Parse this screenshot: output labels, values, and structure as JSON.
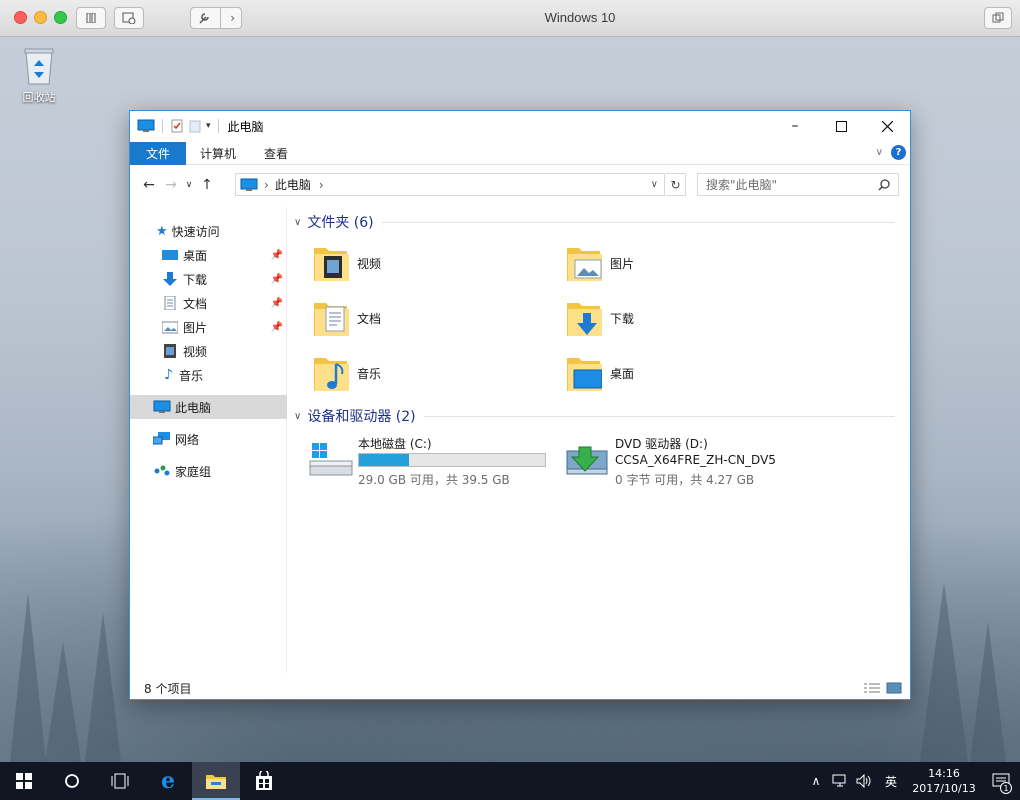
{
  "vm": {
    "title": "Windows 10"
  },
  "desktop": {
    "recycle_bin_label": "回收站"
  },
  "window": {
    "title": "此电脑",
    "ribbon_tabs": [
      {
        "label": "文件",
        "active": true
      },
      {
        "label": "计算机",
        "active": false
      },
      {
        "label": "查看",
        "active": false
      }
    ],
    "help_icon": "?",
    "address": {
      "crumb": "此电脑"
    },
    "search": {
      "placeholder": "搜索\"此电脑\""
    },
    "nav": {
      "quick_access": "快速访问",
      "items": [
        {
          "label": "桌面",
          "pinned": true,
          "icon": "desktop-icon"
        },
        {
          "label": "下载",
          "pinned": true,
          "icon": "download-icon"
        },
        {
          "label": "文档",
          "pinned": true,
          "icon": "documents-icon"
        },
        {
          "label": "图片",
          "pinned": true,
          "icon": "pictures-icon"
        },
        {
          "label": "视频",
          "pinned": false,
          "icon": "videos-icon"
        },
        {
          "label": "音乐",
          "pinned": false,
          "icon": "music-icon"
        }
      ],
      "this_pc": "此电脑",
      "network": "网络",
      "homegroup": "家庭组"
    },
    "groups": {
      "folders_header": "文件夹 (6)",
      "folders": [
        {
          "label": "视频",
          "icon": "videos-folder-icon"
        },
        {
          "label": "图片",
          "icon": "pictures-folder-icon"
        },
        {
          "label": "文档",
          "icon": "documents-folder-icon"
        },
        {
          "label": "下载",
          "icon": "downloads-folder-icon"
        },
        {
          "label": "音乐",
          "icon": "music-folder-icon"
        },
        {
          "label": "桌面",
          "icon": "desktop-folder-icon"
        }
      ],
      "devices_header": "设备和驱动器 (2)",
      "drives": [
        {
          "name": "本地磁盘 (C:)",
          "detail": "29.0 GB 可用，共 39.5 GB",
          "used_fraction": 0.27
        },
        {
          "name": "DVD 驱动器 (D:)",
          "volume": "CCSA_X64FRE_ZH-CN_DV5",
          "detail": "0 字节 可用，共 4.27 GB"
        }
      ]
    },
    "status": {
      "item_count": "8 个项目"
    }
  },
  "taskbar": {
    "ime": "英",
    "time": "14:16",
    "date": "2017/10/13",
    "notification_count": "1"
  },
  "colors": {
    "accent": "#1979ca",
    "group_header": "#1e3287",
    "drive_fill": "#26a0da",
    "taskbar": "#101723"
  }
}
